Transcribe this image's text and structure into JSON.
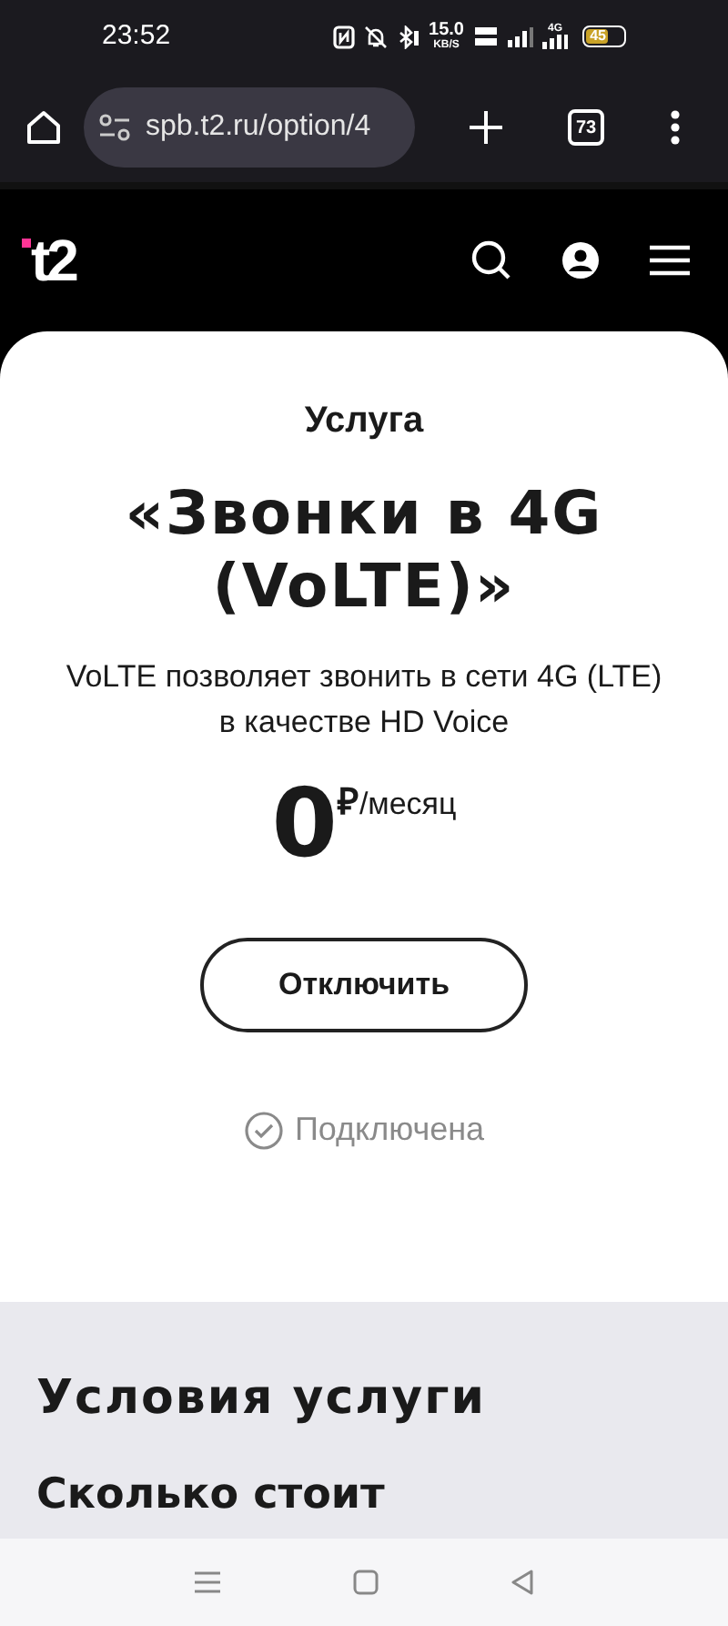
{
  "status_bar": {
    "time": "23:52",
    "speed": "15.0",
    "speed_unit": "KB/S",
    "network": "4G",
    "battery": "45"
  },
  "browser": {
    "url": "spb.t2.ru/option/4",
    "tab_count": "73"
  },
  "header": {
    "logo": "t2"
  },
  "service": {
    "eyebrow": "Услуга",
    "title": "«Звонки в 4G (VoLTE)»",
    "description": "VoLTE позволяет звонить в сети 4G (LTE) в качестве HD Voice",
    "price": "0",
    "currency": "₽",
    "period": "/месяц",
    "button": "Отключить",
    "status": "Подключена",
    "connected": true
  },
  "conditions": {
    "title": "Условия услуги",
    "subtitle": "Сколько стоит"
  }
}
